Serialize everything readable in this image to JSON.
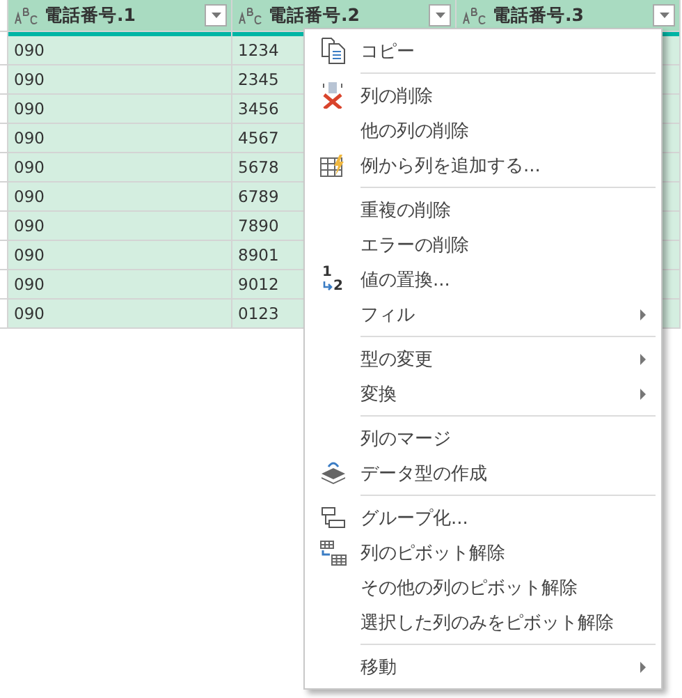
{
  "table": {
    "columns": [
      {
        "name": "電話番号.1",
        "selected": true
      },
      {
        "name": "電話番号.2",
        "selected": true
      },
      {
        "name": "電話番号.3",
        "selected": true
      }
    ],
    "rows": [
      [
        "090",
        "1234"
      ],
      [
        "090",
        "2345"
      ],
      [
        "090",
        "3456"
      ],
      [
        "090",
        "4567"
      ],
      [
        "090",
        "5678"
      ],
      [
        "090",
        "6789"
      ],
      [
        "090",
        "7890"
      ],
      [
        "090",
        "8901"
      ],
      [
        "090",
        "9012"
      ],
      [
        "090",
        "0123"
      ]
    ]
  },
  "context_menu": {
    "items": [
      {
        "kind": "item",
        "label": "コピー",
        "submenu": false
      },
      {
        "kind": "separator"
      },
      {
        "kind": "item",
        "label": "列の削除",
        "submenu": false
      },
      {
        "kind": "item",
        "label": "他の列の削除",
        "submenu": false
      },
      {
        "kind": "item",
        "label": "例から列を追加する...",
        "submenu": false
      },
      {
        "kind": "separator"
      },
      {
        "kind": "item",
        "label": "重複の削除",
        "submenu": false
      },
      {
        "kind": "item",
        "label": "エラーの削除",
        "submenu": false
      },
      {
        "kind": "item",
        "label": "値の置換...",
        "icon_text": [
          "1",
          "2"
        ],
        "submenu": false
      },
      {
        "kind": "item",
        "label": "フィル",
        "submenu": true
      },
      {
        "kind": "separator"
      },
      {
        "kind": "item",
        "label": "型の変更",
        "submenu": true
      },
      {
        "kind": "item",
        "label": "変換",
        "submenu": true
      },
      {
        "kind": "separator"
      },
      {
        "kind": "item",
        "label": "列のマージ",
        "submenu": false
      },
      {
        "kind": "item",
        "label": "データ型の作成",
        "submenu": false
      },
      {
        "kind": "separator"
      },
      {
        "kind": "item",
        "label": "グループ化...",
        "submenu": false
      },
      {
        "kind": "item",
        "label": "列のピボット解除",
        "submenu": false
      },
      {
        "kind": "item",
        "label": "その他の列のピボット解除",
        "submenu": false
      },
      {
        "kind": "item",
        "label": "選択した列のみをピボット解除",
        "submenu": false
      },
      {
        "kind": "separator"
      },
      {
        "kind": "item",
        "label": "移動",
        "submenu": true
      }
    ]
  }
}
